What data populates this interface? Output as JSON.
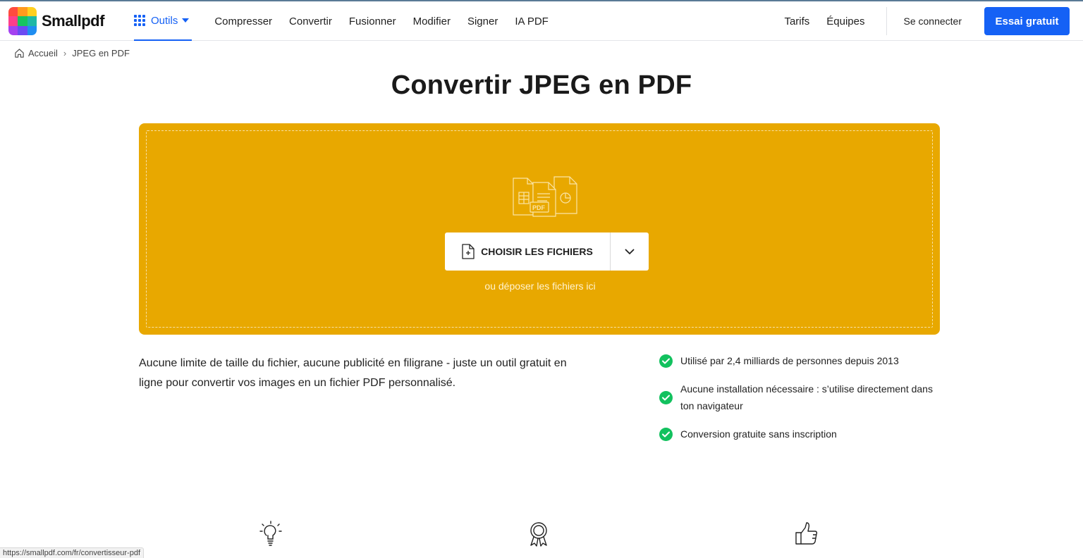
{
  "header": {
    "logo_text": "Smallpdf",
    "logo_colors": [
      "#ff3d3d",
      "#ff8c00",
      "#ffd600",
      "#12c15e",
      "#12c1a6",
      "#1f8ef1",
      "#7b3ff2",
      "#b23ff2",
      "#ff3db6"
    ],
    "tools_label": "Outils",
    "nav_links": [
      "Compresser",
      "Convertir",
      "Fusionner",
      "Modifier",
      "Signer",
      "IA PDF"
    ],
    "right_links": [
      "Tarifs",
      "Équipes"
    ],
    "login_label": "Se connecter",
    "cta_label": "Essai gratuit",
    "accent_color": "#1561f5"
  },
  "breadcrumb": {
    "home": "Accueil",
    "separator": "›",
    "current": "JPEG en PDF"
  },
  "main": {
    "title": "Convertir JPEG en PDF",
    "dropzone": {
      "color": "#e8a800",
      "icon": "files-pdf-icon",
      "pdf_badge": "PDF",
      "choose_label": "CHOISIR LES FICHIERS",
      "drop_hint": "ou déposer les fichiers ici"
    },
    "description": "Aucune limite de taille du fichier, aucune publicité en filigrane - juste un outil gratuit en ligne pour convertir vos images en un fichier PDF personnalisé.",
    "checks": [
      "Utilisé par 2,4 milliards de personnes depuis 2013",
      "Aucune installation nécessaire : s’utilise directement dans ton navigateur",
      "Conversion gratuite sans inscription"
    ],
    "check_color": "#12c15e",
    "feature_icons": [
      "lightbulb-icon",
      "award-ribbon-icon",
      "thumbs-up-icon"
    ]
  },
  "status_bar": {
    "url": "https://smallpdf.com/fr/convertisseur-pdf"
  }
}
